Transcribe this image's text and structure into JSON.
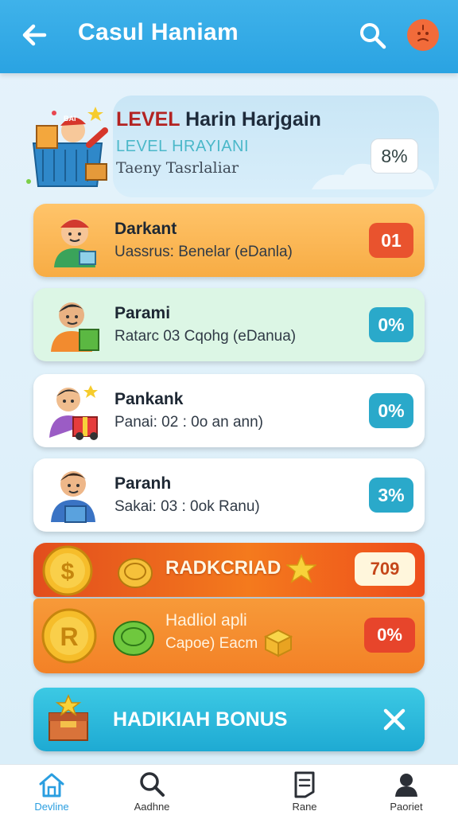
{
  "appbar": {
    "title": "Casul Haniam",
    "icons": [
      "arrow-left-icon",
      "search-icon",
      "alert-face-icon"
    ]
  },
  "level": {
    "title_accent": "LEVEL",
    "title_rest": " Harin Harjgain",
    "subtitle": "LEVEL HRAYIANI",
    "description": "Taeny Tasrlaliar",
    "percent": "8%",
    "illustration_badge": "BAI"
  },
  "tasks": [
    {
      "name": "Darkant",
      "detail": "Uassrus: Benelar (eDanla)",
      "badge": "01"
    },
    {
      "name": "Parami",
      "detail": "Ratarc 03 Cqohg (eDanua)",
      "badge": "0%"
    },
    {
      "name": "Pankank",
      "detail": "Panai: 02 : 0o an ann)",
      "badge": "0%"
    },
    {
      "name": "Paranh",
      "detail": "Sakai: 03 : 0ok Ranu)",
      "badge": "3%"
    }
  ],
  "reward_main": {
    "label": "RADKCRIAD",
    "percent": "709"
  },
  "reward_sub": {
    "label": "Hadliol apli",
    "sub": "Capoe) Eacm",
    "percent": "0%"
  },
  "bonus": {
    "label": "HADIKIAH BONUS"
  },
  "bottom_nav": [
    {
      "label": "Devline",
      "icon": "home-icon"
    },
    {
      "label": "Aadhne",
      "icon": "search-icon"
    },
    {
      "label": "Rane",
      "icon": "document-icon"
    },
    {
      "label": "Paoriet",
      "icon": "profile-icon"
    }
  ],
  "colors": {
    "appbar": "#2aa3e2",
    "orange_task": "#f7ac44",
    "green_task": "#dcf6e5",
    "badge_red": "#e9532e",
    "badge_teal": "#2aa9ca",
    "bonus": "#1eaad3",
    "nav_active": "#2a9ee0"
  }
}
